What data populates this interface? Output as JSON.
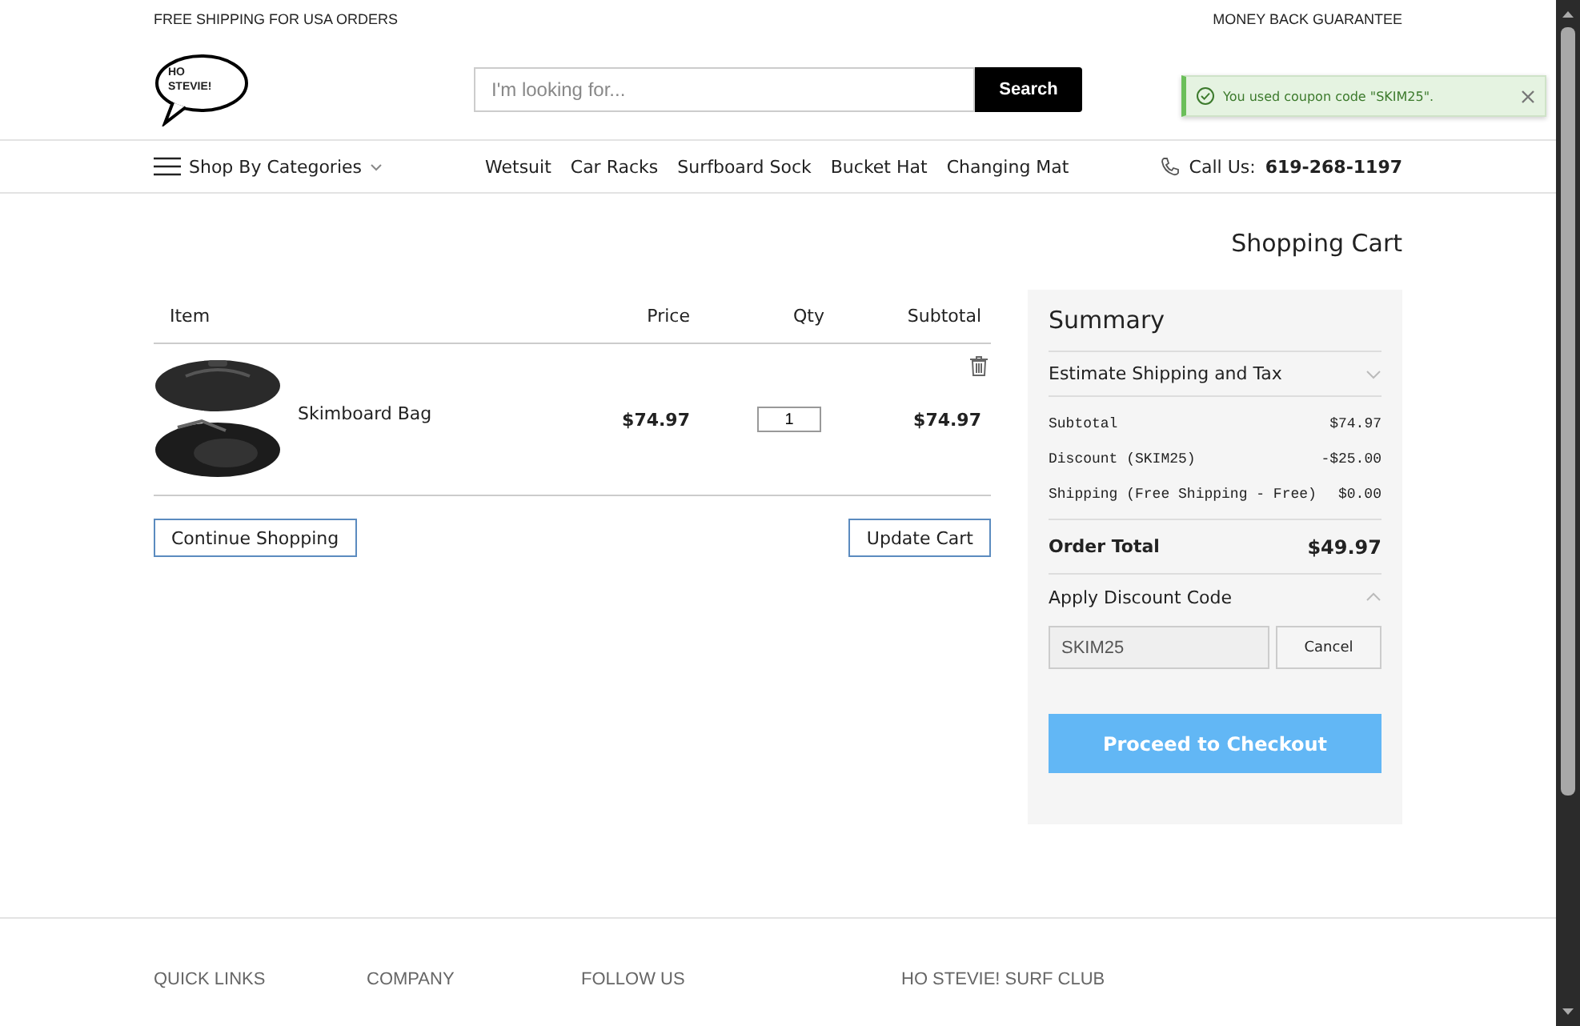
{
  "top_bar": {
    "left": "FREE SHIPPING FOR USA ORDERS",
    "right": "MONEY BACK GUARANTEE"
  },
  "logo": {
    "text": "HO STEVIE!"
  },
  "search": {
    "placeholder": "I'm looking for...",
    "button": "Search"
  },
  "toast": {
    "message": "You used coupon code \"SKIM25\"."
  },
  "nav": {
    "categories": "Shop By Categories",
    "links": [
      "Wetsuit",
      "Car Racks",
      "Surfboard Sock",
      "Bucket Hat",
      "Changing Mat"
    ],
    "call_label": "Call Us:",
    "phone": "619-268-1197"
  },
  "page_title": "Shopping Cart",
  "cart": {
    "columns": [
      "Item",
      "Price",
      "Qty",
      "Subtotal"
    ],
    "rows": [
      {
        "name": "Skimboard Bag",
        "price": "$74.97",
        "qty": "1",
        "subtotal": "$74.97"
      }
    ],
    "continue_button": "Continue Shopping",
    "update_button": "Update Cart"
  },
  "summary": {
    "title": "Summary",
    "shipping_section": {
      "label": "Estimate Shipping and Tax",
      "expanded": false
    },
    "lines": [
      {
        "label": "Subtotal",
        "value": "$74.97"
      },
      {
        "label": "Discount (SKIM25)",
        "value": "-$25.00"
      },
      {
        "label": "Shipping (Free Shipping - Free)",
        "value": "$0.00"
      }
    ],
    "total_label": "Order Total",
    "total_value": "$49.97",
    "discount_section": {
      "label": "Apply Discount Code",
      "expanded": true,
      "value": "SKIM25",
      "cancel": "Cancel"
    },
    "checkout": "Proceed to Checkout"
  },
  "footer": {
    "headings": [
      "QUICK LINKS",
      "COMPANY",
      "FOLLOW US",
      "HO STEVIE! SURF CLUB"
    ]
  }
}
